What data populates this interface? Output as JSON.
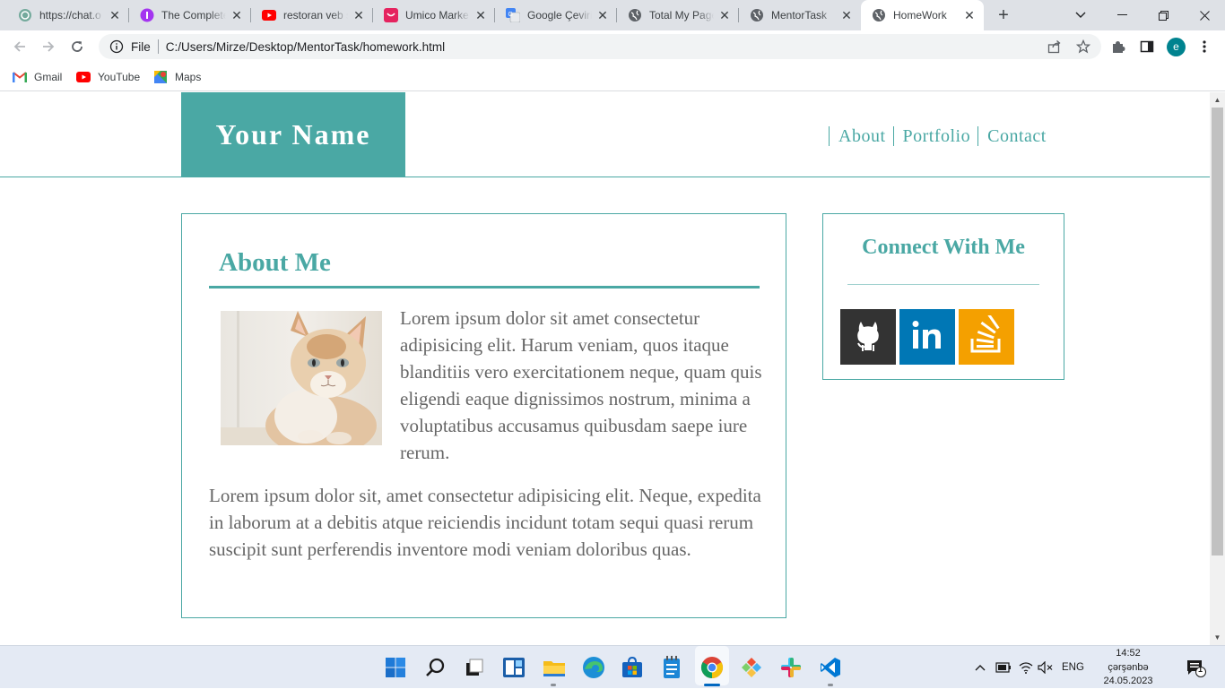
{
  "browser": {
    "tabs": [
      {
        "title": "https://chat.o",
        "icon": "chatgpt-icon"
      },
      {
        "title": "The Complete",
        "icon": "complete-icon"
      },
      {
        "title": "restoran veb s",
        "icon": "youtube-icon"
      },
      {
        "title": "Umico Marke",
        "icon": "umico-icon"
      },
      {
        "title": "Google Çeviri",
        "icon": "google-translate-icon"
      },
      {
        "title": "Total My Page",
        "icon": "globe-icon"
      },
      {
        "title": "MentorTask",
        "icon": "globe-icon"
      },
      {
        "title": "HomeWork",
        "icon": "globe-icon",
        "active": true
      }
    ],
    "scheme_label": "File",
    "url": "C:/Users/Mirze/Desktop/MentorTask/homework.html",
    "profile_initial": "e",
    "bookmarks": [
      {
        "label": "Gmail",
        "icon": "gmail-icon"
      },
      {
        "label": "YouTube",
        "icon": "youtube-icon"
      },
      {
        "label": "Maps",
        "icon": "maps-icon"
      }
    ]
  },
  "page": {
    "brand": "Your Name",
    "nav": [
      "About",
      "Portfolio",
      "Contact"
    ],
    "about": {
      "title": "About Me",
      "image": "cat-photo",
      "para1": "Lorem ipsum dolor sit amet consectetur adipisicing elit. Harum veniam, quos itaque blanditiis vero exercitationem neque, quam quis eligendi eaque dignissimos nostrum, minima a voluptatibus accusamus quibusdam saepe iure rerum.",
      "para2": "Lorem ipsum dolor sit, amet consectetur adipisicing elit. Neque, expedita in laborum at a debitis atque reiciendis incidunt totam sequi quasi rerum suscipit sunt perferendis inventore modi veniam doloribus quas."
    },
    "connect": {
      "title": "Connect With Me",
      "links": [
        {
          "icon": "github-icon",
          "color": "#333333"
        },
        {
          "icon": "linkedin-icon",
          "color": "#0077b5"
        },
        {
          "icon": "stackoverflow-icon",
          "color": "#f4a000"
        }
      ]
    },
    "accent_color": "#4aa8a4"
  },
  "taskbar": {
    "language": "ENG",
    "time": "14:52",
    "day": "çərşənbə",
    "date": "24.05.2023",
    "notification_count": "1"
  }
}
